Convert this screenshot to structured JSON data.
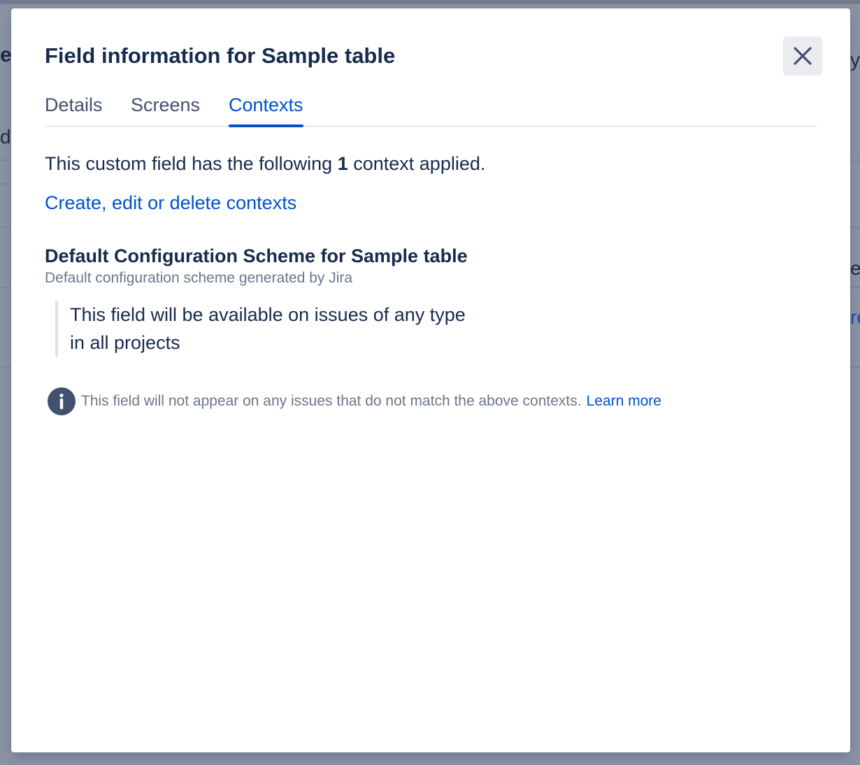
{
  "background": {
    "left_fragment_1": "e|",
    "left_fragment_2": "d",
    "right_fragment_1": "y",
    "right_fragment_2": "er",
    "right_fragment_3": "re"
  },
  "modal": {
    "title": "Field information for Sample table",
    "close_icon": "close-icon",
    "tabs": [
      {
        "label": "Details",
        "active": false
      },
      {
        "label": "Screens",
        "active": false
      },
      {
        "label": "Contexts",
        "active": true
      }
    ],
    "summary": {
      "prefix": "This custom field has the following ",
      "count": "1",
      "suffix": " context applied."
    },
    "contexts_link": "Create, edit or delete contexts",
    "scheme": {
      "name": "Default Configuration Scheme for Sample table",
      "description": "Default configuration scheme generated by Jira",
      "scope_lines": [
        "This field will be available on issues of any type",
        "in all projects"
      ]
    },
    "info": {
      "icon": "info-icon",
      "text": "This field will not appear on any issues that do not match the above contexts.",
      "link": "Learn more"
    }
  },
  "colors": {
    "primary_text": "#172b4d",
    "secondary_text": "#6b778c",
    "link": "#0052cc",
    "tab_inactive": "#42526e",
    "info_icon": "#42526e",
    "blanket": "#8991a3"
  }
}
